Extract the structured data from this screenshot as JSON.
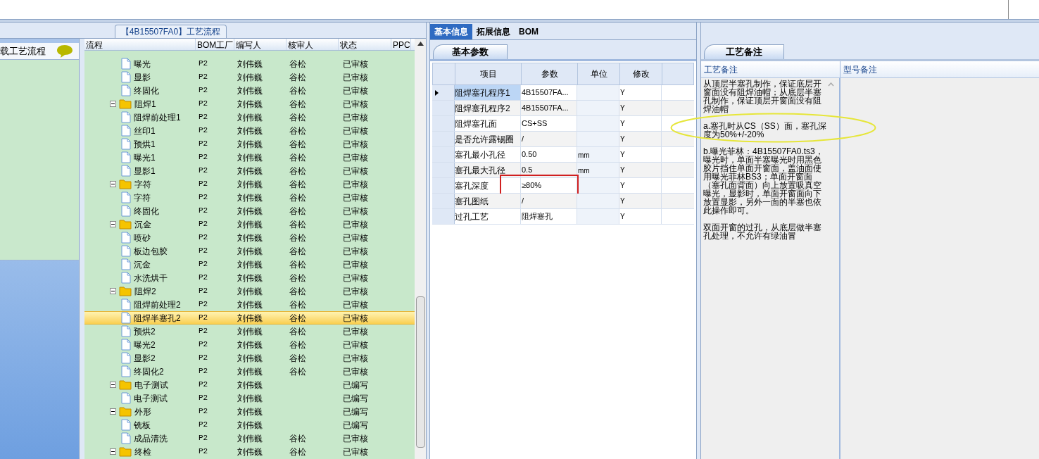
{
  "flow_panel": {
    "title": "【4B15507FA0】工艺流程"
  },
  "side_list": {
    "item": "载工艺流程"
  },
  "tree_columns": [
    "流程",
    "BOM工厂",
    "编写人",
    "核审人",
    "状态",
    "PPC"
  ],
  "tree": [
    {
      "children": [
        {
          "name": "曝光",
          "bom": "P2",
          "writer": "刘伟巍",
          "reviewer": "谷松",
          "status": "已审核",
          "selected": false
        },
        {
          "name": "显影",
          "bom": "P2",
          "writer": "刘伟巍",
          "reviewer": "谷松",
          "status": "已审核",
          "selected": false
        },
        {
          "name": "终固化",
          "bom": "P2",
          "writer": "刘伟巍",
          "reviewer": "谷松",
          "status": "已审核",
          "selected": false
        }
      ]
    },
    {
      "name": "阻焊1",
      "bom": "P2",
      "writer": "刘伟巍",
      "reviewer": "谷松",
      "status": "已审核",
      "expanded": true,
      "children": [
        {
          "name": "阻焊前处理1",
          "bom": "P2",
          "writer": "刘伟巍",
          "reviewer": "谷松",
          "status": "已审核",
          "selected": false
        },
        {
          "name": "丝印1",
          "bom": "P2",
          "writer": "刘伟巍",
          "reviewer": "谷松",
          "status": "已审核",
          "selected": false
        },
        {
          "name": "预烘1",
          "bom": "P2",
          "writer": "刘伟巍",
          "reviewer": "谷松",
          "status": "已审核",
          "selected": false
        },
        {
          "name": "曝光1",
          "bom": "P2",
          "writer": "刘伟巍",
          "reviewer": "谷松",
          "status": "已审核",
          "selected": false
        },
        {
          "name": "显影1",
          "bom": "P2",
          "writer": "刘伟巍",
          "reviewer": "谷松",
          "status": "已审核",
          "selected": false
        }
      ]
    },
    {
      "name": "字符",
      "bom": "P2",
      "writer": "刘伟巍",
      "reviewer": "谷松",
      "status": "已审核",
      "expanded": true,
      "children": [
        {
          "name": "字符",
          "bom": "P2",
          "writer": "刘伟巍",
          "reviewer": "谷松",
          "status": "已审核",
          "selected": false
        },
        {
          "name": "终固化",
          "bom": "P2",
          "writer": "刘伟巍",
          "reviewer": "谷松",
          "status": "已审核",
          "selected": false
        }
      ]
    },
    {
      "name": "沉金",
      "bom": "P2",
      "writer": "刘伟巍",
      "reviewer": "谷松",
      "status": "已审核",
      "expanded": true,
      "children": [
        {
          "name": "喷砂",
          "bom": "P2",
          "writer": "刘伟巍",
          "reviewer": "谷松",
          "status": "已审核",
          "selected": false
        },
        {
          "name": "板边包胶",
          "bom": "P2",
          "writer": "刘伟巍",
          "reviewer": "谷松",
          "status": "已审核",
          "selected": false
        },
        {
          "name": "沉金",
          "bom": "P2",
          "writer": "刘伟巍",
          "reviewer": "谷松",
          "status": "已审核",
          "selected": false
        },
        {
          "name": "水洗烘干",
          "bom": "P2",
          "writer": "刘伟巍",
          "reviewer": "谷松",
          "status": "已审核",
          "selected": false
        }
      ]
    },
    {
      "name": "阻焊2",
      "bom": "P2",
      "writer": "刘伟巍",
      "reviewer": "谷松",
      "status": "已审核",
      "expanded": true,
      "children": [
        {
          "name": "阻焊前处理2",
          "bom": "P2",
          "writer": "刘伟巍",
          "reviewer": "谷松",
          "status": "已审核",
          "selected": false
        },
        {
          "name": "阻焊半塞孔2",
          "bom": "P2",
          "writer": "刘伟巍",
          "reviewer": "谷松",
          "status": "已审核",
          "selected": true
        },
        {
          "name": "预烘2",
          "bom": "P2",
          "writer": "刘伟巍",
          "reviewer": "谷松",
          "status": "已审核",
          "selected": false
        },
        {
          "name": "曝光2",
          "bom": "P2",
          "writer": "刘伟巍",
          "reviewer": "谷松",
          "status": "已审核",
          "selected": false
        },
        {
          "name": "显影2",
          "bom": "P2",
          "writer": "刘伟巍",
          "reviewer": "谷松",
          "status": "已审核",
          "selected": false
        },
        {
          "name": "终固化2",
          "bom": "P2",
          "writer": "刘伟巍",
          "reviewer": "谷松",
          "status": "已审核",
          "selected": false
        }
      ]
    },
    {
      "name": "电子测试",
      "bom": "P2",
      "writer": "刘伟巍",
      "status": "已编写",
      "expanded": true,
      "children": [
        {
          "name": "电子测试",
          "bom": "P2",
          "writer": "刘伟巍",
          "status": "已编写",
          "selected": false
        }
      ]
    },
    {
      "name": "外形",
      "bom": "P2",
      "writer": "刘伟巍",
      "status": "已编写",
      "expanded": true,
      "children": [
        {
          "name": "铣板",
          "bom": "P2",
          "writer": "刘伟巍",
          "status": "已编写",
          "selected": false
        },
        {
          "name": "成品清洗",
          "bom": "P2",
          "writer": "刘伟巍",
          "reviewer": "谷松",
          "status": "已审核",
          "selected": false
        }
      ]
    },
    {
      "name": "终检",
      "bom": "P2",
      "writer": "刘伟巍",
      "reviewer": "谷松",
      "status": "已审核",
      "expanded": true
    }
  ],
  "tabs": [
    {
      "label": "基本信息",
      "selected": true
    },
    {
      "label": "拓展信息",
      "selected": false
    },
    {
      "label": "BOM",
      "selected": false
    }
  ],
  "params_tab": "基本参数",
  "param_columns": [
    "项目",
    "参数",
    "单位",
    "修改"
  ],
  "params": [
    {
      "item": "阻焊塞孔程序1",
      "value": "4B15507FA...",
      "modified": "Y",
      "current": true,
      "selected": true,
      "flagged": false
    },
    {
      "item": "阻焊塞孔程序2",
      "value": "4B15507FA...",
      "modified": "Y",
      "current": false,
      "selected": false,
      "flagged": false
    },
    {
      "item": "阻焊塞孔面",
      "value": "CS+SS",
      "modified": "Y",
      "current": false,
      "selected": false,
      "flagged": false
    },
    {
      "item": "是否允许露锡圈",
      "value": "/",
      "modified": "Y",
      "current": false,
      "selected": false,
      "flagged": false
    },
    {
      "item": "塞孔最小孔径",
      "value": "0.50",
      "unit": "mm",
      "modified": "Y",
      "current": false,
      "selected": false,
      "flagged": false
    },
    {
      "item": "塞孔最大孔径",
      "value": "0.5",
      "unit": "mm",
      "modified": "Y",
      "current": false,
      "selected": false,
      "flagged": false
    },
    {
      "item": "塞孔深度",
      "value": "≥80%",
      "modified": "Y",
      "current": false,
      "selected": false,
      "flagged": true
    },
    {
      "item": "塞孔图纸",
      "value": "/",
      "modified": "Y",
      "current": false,
      "selected": false,
      "flagged": false
    },
    {
      "item": "过孔工艺",
      "value": "阻焊塞孔",
      "modified": "Y",
      "current": false,
      "selected": false,
      "flagged": false
    }
  ],
  "notes_tab": "工艺备注",
  "notes_columns": [
    "工艺备注",
    "型号备注"
  ],
  "notes": [
    {
      "text": "从顶层半塞孔制作，保证底层开窗面没有阻焊油帽；从底层半塞孔制作，保证顶层开窗面没有阻焊油帽"
    },
    {
      "text": "a.塞孔时从CS（SS）面，塞孔深度为50%+/-20%"
    },
    {
      "text": "b.曝光菲林：4B15507FA0.ts3，曝光时，单面半塞曝光时用黑色胶片挡住单面开窗面，盖油面使用曝光菲林BS3；单面开窗面（塞孔面背面）向上放置吸真空曝光，显影时，单面开窗面向下放置显影，另外一面的半塞也依此操作即可。"
    },
    {
      "text": "双面开窗的过孔，从底层做半塞孔处理，不允许有绿油冒"
    }
  ],
  "annotations": [
    {
      "kind": "ellipse"
    }
  ]
}
